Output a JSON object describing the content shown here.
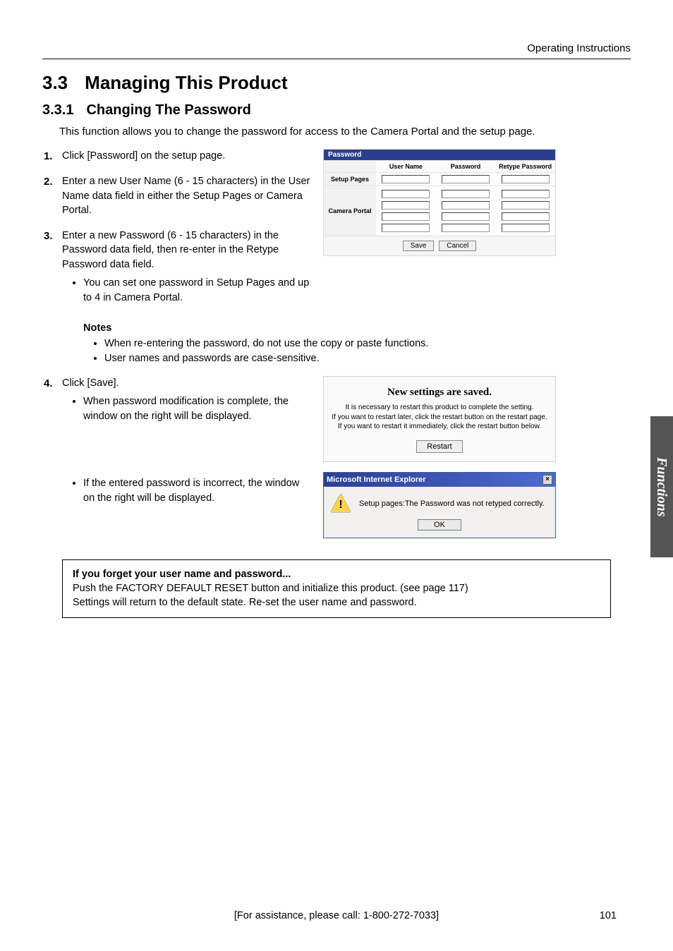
{
  "header": {
    "doc_title": "Operating Instructions"
  },
  "section": {
    "num": "3.3",
    "title": "Managing This Product",
    "sub_num": "3.3.1",
    "sub_title": "Changing The Password",
    "intro": "This function allows you to change the password for access to the Camera Portal and the setup page."
  },
  "steps": {
    "s1": {
      "n": "1.",
      "text": "Click [Password] on the setup page."
    },
    "s2": {
      "n": "2.",
      "text": "Enter a new User Name (6 - 15 characters) in the User Name data field in either the Setup Pages or Camera Portal."
    },
    "s3": {
      "n": "3.",
      "text": "Enter a new Password (6 - 15 characters) in the Password data field, then re-enter in the Retype Password data field.",
      "bullet": "You can set one password in Setup Pages and up to 4 in Camera Portal."
    },
    "notes_head": "Notes",
    "note1": "When re-entering the password, do not use the copy or paste functions.",
    "note2": "User names and passwords are case-sensitive.",
    "s4": {
      "n": "4.",
      "text": "Click [Save].",
      "bullet1": "When password modification is complete, the window on the right will be displayed.",
      "bullet2": "If the entered password is incorrect, the window on the right will be displayed."
    }
  },
  "pw_panel": {
    "title": "Password",
    "cols": {
      "c1": "User Name",
      "c2": "Password",
      "c3": "Retype Password"
    },
    "rows": {
      "r1": "Setup Pages",
      "r2": "Camera Portal"
    },
    "save": "Save",
    "cancel": "Cancel"
  },
  "saved_panel": {
    "title": "New settings are saved.",
    "line1": "It is necessary to restart this product to complete the setting.",
    "line2": "If you want to restart later, click the restart button on the restart page.",
    "line3": "If you want to restart it immediately, click the restart button below.",
    "button": "Restart"
  },
  "ie_dialog": {
    "title": "Microsoft Internet Explorer",
    "msg": "Setup pages:The Password was not retyped correctly.",
    "ok": "OK",
    "close": "×"
  },
  "box": {
    "title": "If you forget your user name and password...",
    "line1": "Push the FACTORY DEFAULT RESET button and initialize this product. (see page 117)",
    "line2": "Settings will return to the default state. Re-set the user name and password."
  },
  "sidetab": "Functions",
  "footer": "[For assistance, please call: 1-800-272-7033]",
  "page": "101"
}
